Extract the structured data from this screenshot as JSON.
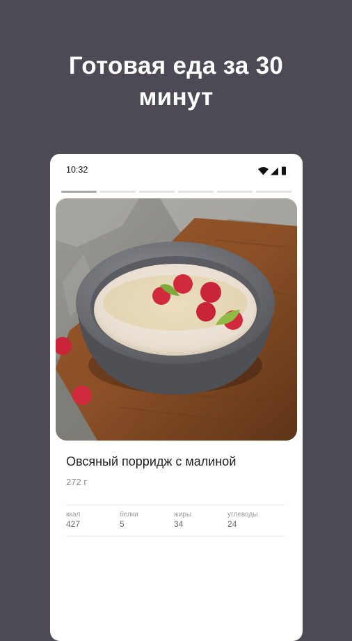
{
  "promo": {
    "headline_line1": "Готовая еда за 30",
    "headline_line2": "минут"
  },
  "statusbar": {
    "time": "10:32",
    "icons": [
      "wifi-icon",
      "signal-icon",
      "battery-icon"
    ]
  },
  "stories": {
    "segment_count": 6,
    "active_index": 0
  },
  "dish": {
    "image": "oatmeal-porridge-with-raspberries-photo",
    "title": "Овсяный порридж с малиной",
    "weight": "272 г"
  },
  "nutrition": [
    {
      "label": "ккал",
      "value": "427"
    },
    {
      "label": "белки",
      "value": "5"
    },
    {
      "label": "жиры",
      "value": "34"
    },
    {
      "label": "углеводы",
      "value": "24"
    }
  ],
  "colors": {
    "background": "#4d4a56",
    "card": "#ffffff",
    "title_text": "#1e1e1e",
    "muted_text": "#8a8a8a",
    "raspberry": "#d22a3d"
  }
}
